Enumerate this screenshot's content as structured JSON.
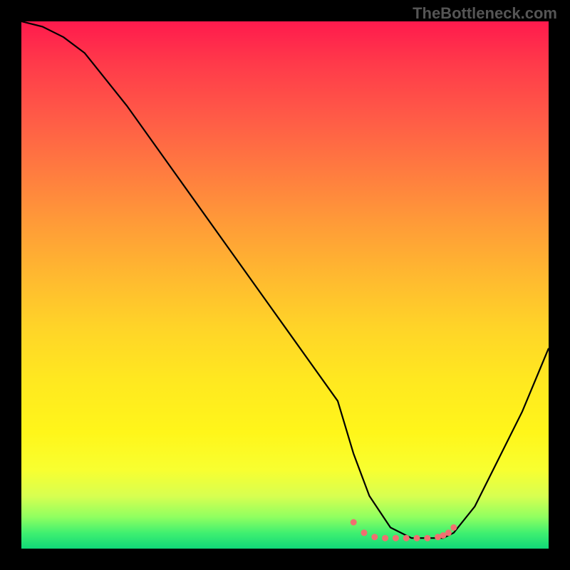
{
  "attribution": "TheBottleneck.com",
  "chart_data": {
    "type": "line",
    "title": "",
    "xlabel": "",
    "ylabel": "",
    "xlim": [
      0,
      100
    ],
    "ylim": [
      0,
      100
    ],
    "series": [
      {
        "name": "curve",
        "x": [
          0,
          4,
          8,
          12,
          20,
          30,
          40,
          50,
          60,
          63,
          66,
          70,
          74,
          78,
          80,
          82,
          86,
          90,
          95,
          100
        ],
        "y": [
          100,
          99,
          97,
          94,
          84,
          70,
          56,
          42,
          28,
          18,
          10,
          4,
          2,
          2,
          2,
          3,
          8,
          16,
          26,
          38
        ]
      }
    ],
    "markers": {
      "name": "flat-region-dots",
      "color": "#f07070",
      "x": [
        63,
        65,
        67,
        69,
        71,
        73,
        75,
        77,
        79,
        80,
        81,
        82
      ],
      "y": [
        5,
        3,
        2.2,
        2,
        2,
        2,
        2,
        2,
        2.2,
        2.5,
        3,
        4
      ]
    },
    "background_gradient": {
      "top": "#ff1a4d",
      "mid": "#ffe820",
      "bottom": "#10d878"
    }
  }
}
